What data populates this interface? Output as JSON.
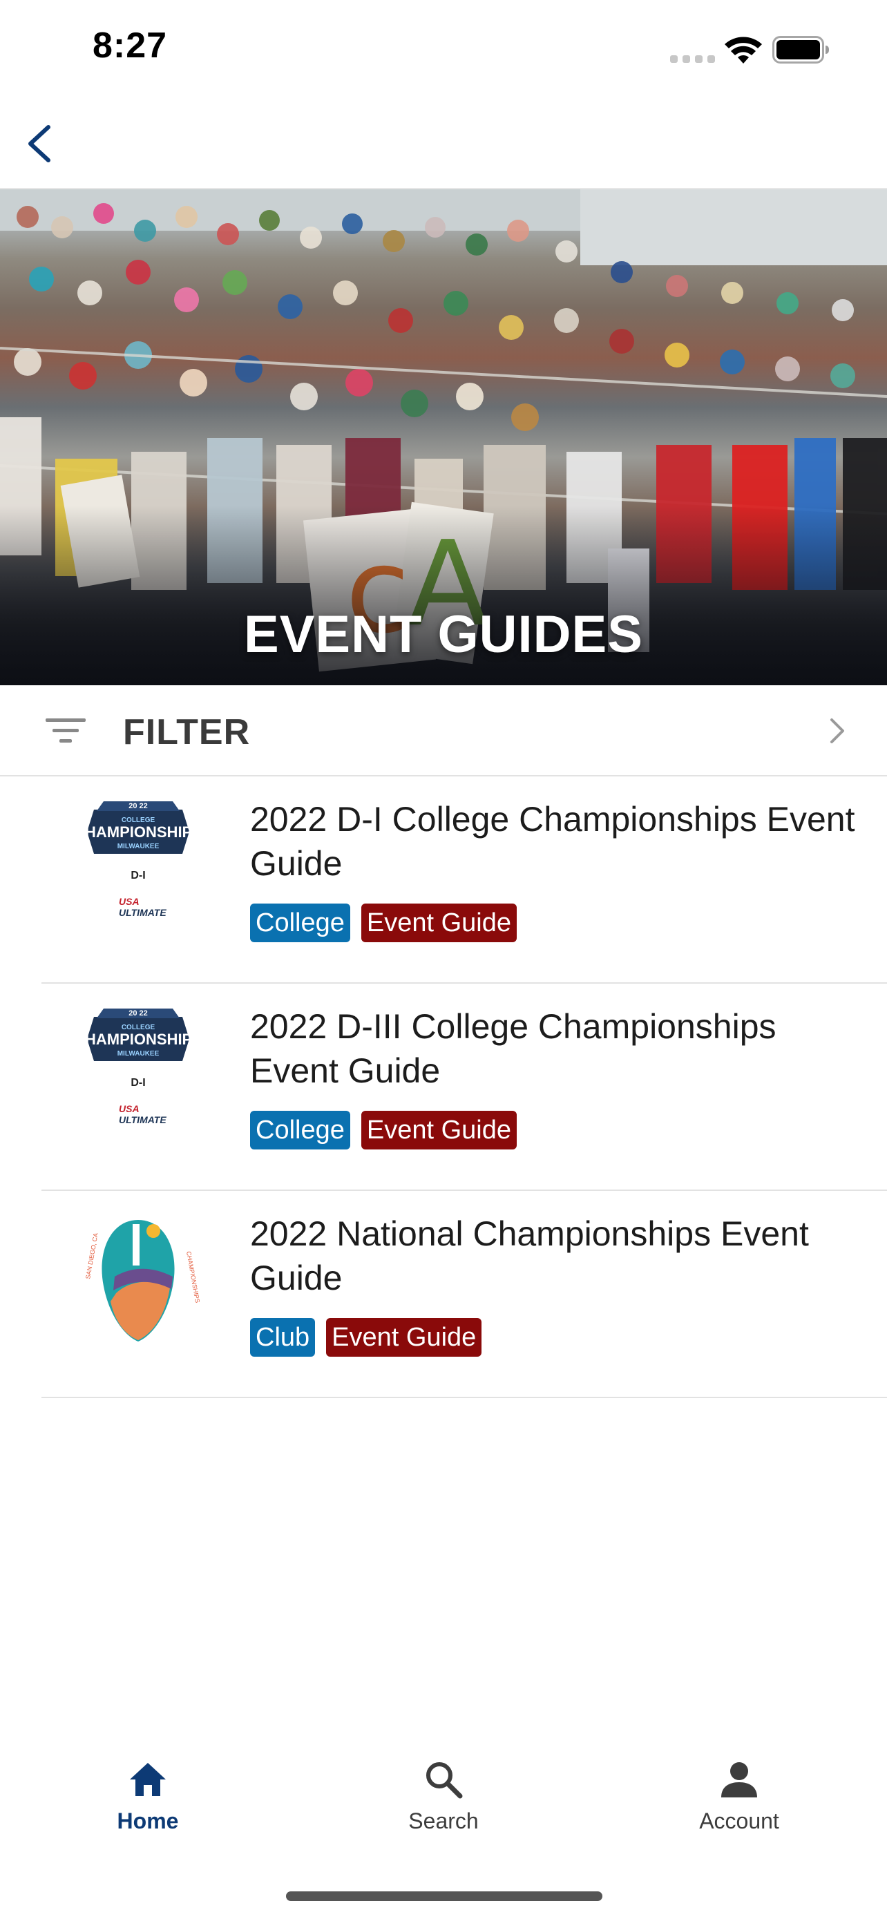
{
  "status_bar": {
    "time": "8:27"
  },
  "nav": {
    "back_icon": "chevron-left-icon"
  },
  "hero": {
    "title": "EVENT GUIDES",
    "image": "crowd-of-spectators-photo"
  },
  "filter": {
    "label": "FILTER",
    "icon": "filter-lines-icon",
    "chevron": "chevron-right-icon"
  },
  "events": [
    {
      "title": "2022 D-I College Championships Event Guide",
      "logo": "college-championships-milwaukee-logo",
      "tags": [
        "College",
        "Event Guide"
      ]
    },
    {
      "title": "2022 D-III College Championships Event Guide",
      "logo": "college-championships-milwaukee-logo",
      "tags": [
        "College",
        "Event Guide"
      ]
    },
    {
      "title": "2022 National Championships Event Guide",
      "logo": "national-championships-san-diego-logo",
      "tags": [
        "Club",
        "Event Guide"
      ]
    }
  ],
  "tab_bar": {
    "items": [
      {
        "label": "Home",
        "icon": "home-icon",
        "active": true
      },
      {
        "label": "Search",
        "icon": "search-icon",
        "active": false
      },
      {
        "label": "Account",
        "icon": "person-icon",
        "active": false
      }
    ]
  },
  "colors": {
    "accent": "#0d3a75",
    "tag_blue": "#0a71b0",
    "tag_red": "#8a0a0a"
  }
}
